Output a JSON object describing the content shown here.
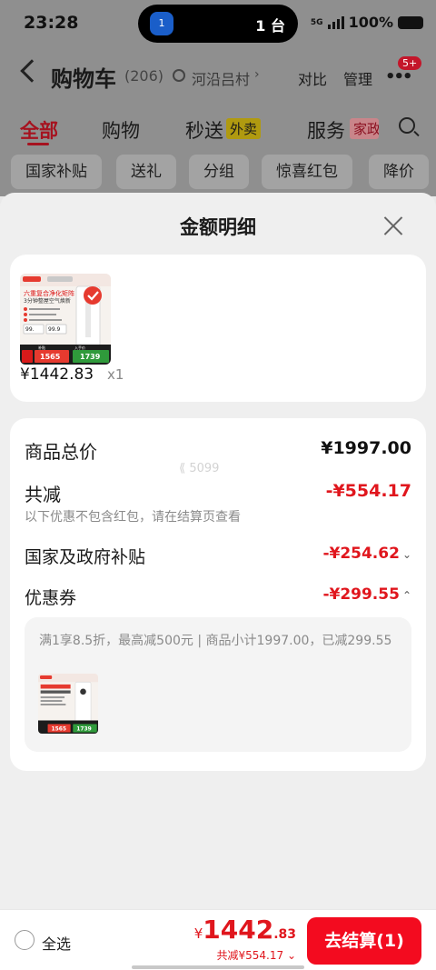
{
  "status_bar": {
    "time": "23:28",
    "island_icon_text": "1",
    "island_text": "1 台",
    "network": "5G",
    "battery": "100%"
  },
  "header": {
    "title": "购物车",
    "count": "(206)",
    "location": "河沿吕村",
    "location_chevron": "›",
    "compare": "对比",
    "manage": "管理",
    "more_icon": "•••",
    "more_badge": "5+"
  },
  "tabs": [
    {
      "label": "全部"
    },
    {
      "label": "购物"
    },
    {
      "label": "秒送",
      "badge": "外卖"
    },
    {
      "label": "服务",
      "badge": "家政"
    }
  ],
  "chips": [
    "国家补贴",
    "送礼",
    "分组",
    "惊喜红包",
    "降价"
  ],
  "sheet": {
    "title": "金额明细",
    "product": {
      "price": "¥1442.83",
      "quantity": "x1",
      "image_texts": [
        "六重复合净化矩阵",
        "3分钟整屋空气焕新",
        "99.",
        "99.9",
        "1565",
        "1739",
        "补贴",
        "入手价"
      ]
    },
    "watermark": "⟪ 5099",
    "rows": {
      "total_label": "商品总价",
      "total_value": "¥1997.00",
      "reduce_label": "共减",
      "reduce_value": "-¥554.17",
      "note": "以下优惠不包含红包，请在结算页查看",
      "subsidy_label": "国家及政府补贴",
      "subsidy_value": "-¥254.62",
      "subsidy_chevron": "⌄",
      "coupon_label": "优惠券",
      "coupon_value": "-¥299.55",
      "coupon_chevron": "⌃"
    },
    "coupon_detail": "满1享8.5折，最高减500元 | 商品小计1997.00，已减299.55"
  },
  "bottom_bar": {
    "select_all": "全选",
    "total_currency": "¥",
    "total_int": "1442",
    "total_dec": ".83",
    "saved": "共减¥554.17 ⌄",
    "checkout": "去结算(1)"
  },
  "colors": {
    "accent_red": "#e0161d",
    "checkout_bg": "#f30b1f",
    "overlay": "#8f8f8f"
  }
}
